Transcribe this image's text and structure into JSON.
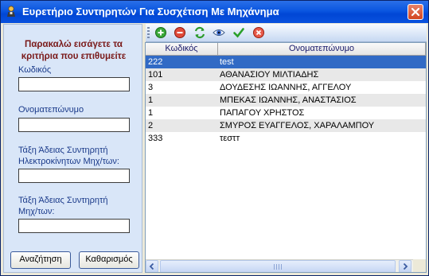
{
  "window": {
    "title": "Ευρετήριο Συντηρητών Για Συσχέτιση Με Μηχάνημα"
  },
  "form": {
    "prompt_line1": "Παρακαλώ εισάγετε τα",
    "prompt_line2": "κριτήρια που επιθυμείτε",
    "code_label": "Κωδικός",
    "code_value": "",
    "name_label": "Ονοματεπώνυμο",
    "name_value": "",
    "license_elec_label_1": "Τάξη Άδειας Συντηρητή",
    "license_elec_label_2": "Ηλεκτροκίνητων Μηχ/των:",
    "license_elec_value": "",
    "license_label_1": "Τάξη Άδειας Συντηρητή",
    "license_label_2": "Μηχ/των:",
    "license_value": "",
    "search_label": "Αναζήτηση",
    "clear_label": "Καθαρισμός"
  },
  "toolbar": {
    "icons": [
      "add-icon",
      "remove-icon",
      "refresh-icon",
      "view-icon",
      "confirm-icon",
      "cancel-icon"
    ]
  },
  "grid": {
    "columns": [
      "Κωδικός",
      "Ονοματεπώνυμο"
    ],
    "rows": [
      {
        "code": "222",
        "name": "test",
        "selected": true
      },
      {
        "code": "101",
        "name": "ΑΘΑΝΑΣΙΟΥ ΜΙΛΤΙΑΔΗΣ"
      },
      {
        "code": "3",
        "name": "ΔΟΥΔΕΣΗΣ ΙΩΑΝΝΗΣ, ΑΓΓΕΛΟΥ"
      },
      {
        "code": "1",
        "name": "ΜΠΕΚΑΣ ΙΩΑΝΝΗΣ, ΑΝΑΣΤΑΣΙΟΣ"
      },
      {
        "code": "1",
        "name": "ΠΑΠΑΓΟΥ ΧΡΗΣΤΟΣ"
      },
      {
        "code": "2",
        "name": "ΣΜΥΡΟΣ ΕΥΑΓΓΕΛΟΣ, ΧΑΡΑΛΑΜΠΟΥ"
      },
      {
        "code": "333",
        "name": "τεστт"
      }
    ]
  },
  "colors": {
    "title_bar": "#0a56e0",
    "selection": "#316ac5",
    "panel": "#d9e6f8",
    "prompt_text": "#7a1a1a"
  }
}
